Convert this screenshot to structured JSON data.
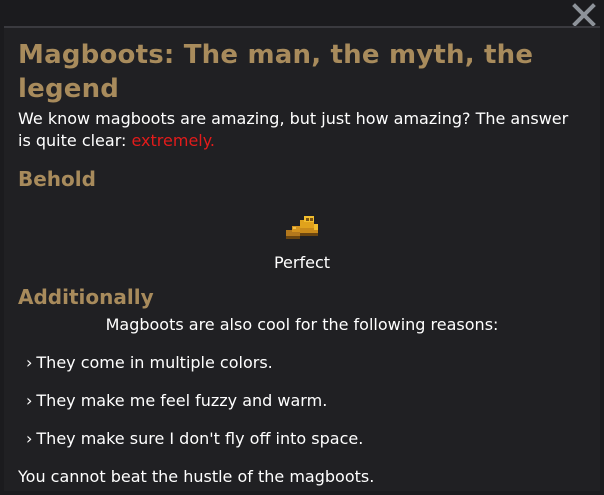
{
  "window": {
    "close_icon": "close-x-icon"
  },
  "page": {
    "title": "Magboots: The man, the myth, the legend",
    "intro_text": "We know magboots are amazing, but just how amazing? The answer is quite clear: ",
    "intro_highlight": "extremely.",
    "highlight_color": "#e21b1b",
    "heading_color": "#a88b5c"
  },
  "behold": {
    "heading": "Behold",
    "image_icon": "magboots-icon",
    "caption": "Perfect"
  },
  "additionally": {
    "heading": "Additionally",
    "lead": "Magboots are also cool for the following reasons:",
    "reasons": [
      "They come in multiple colors.",
      "They make me feel fuzzy and warm.",
      "They make sure I don't fly off into space."
    ],
    "bullet": "›",
    "outro": "You cannot beat the hustle of the magboots."
  }
}
